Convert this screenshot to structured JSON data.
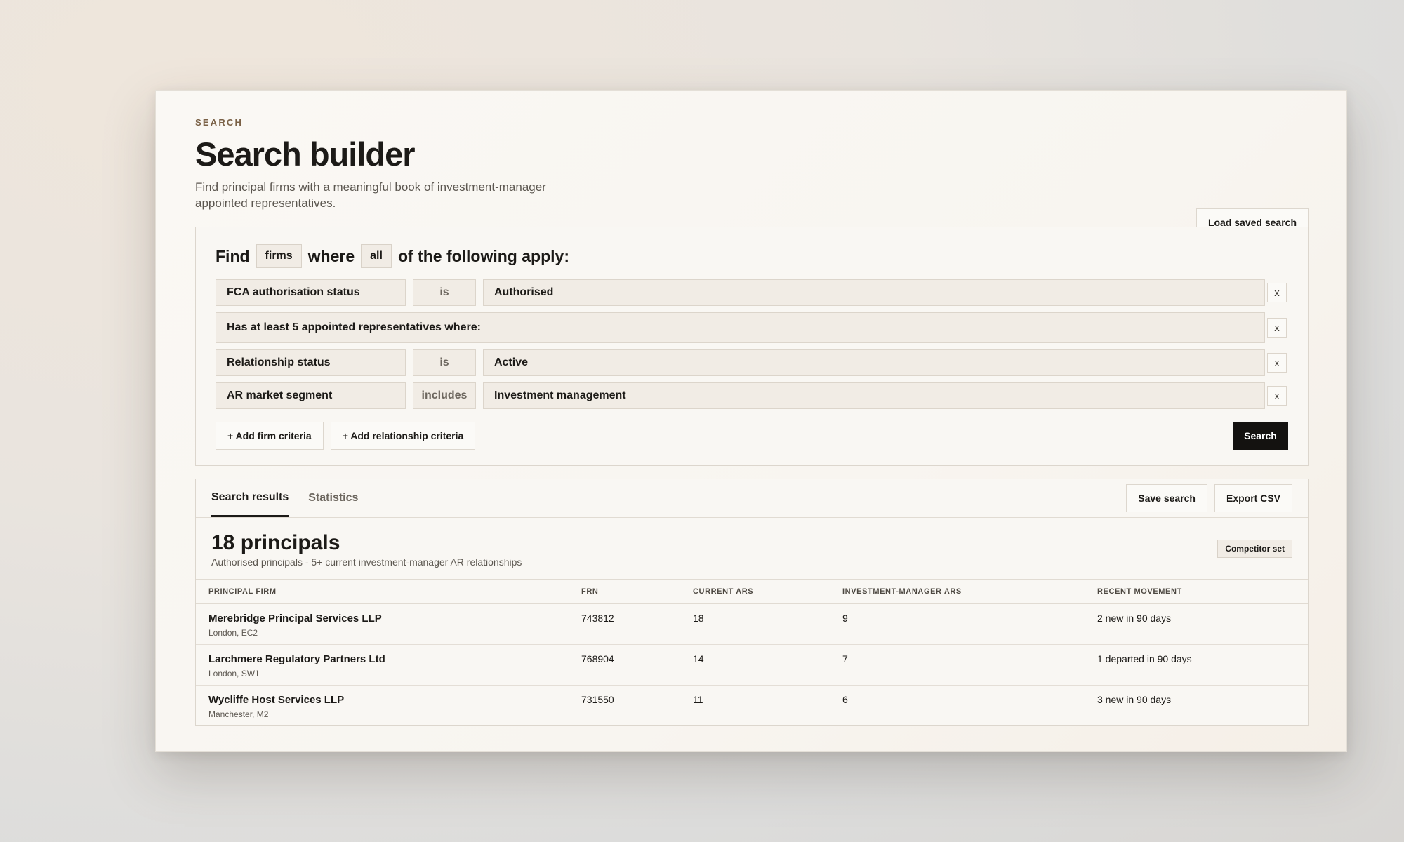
{
  "header": {
    "eyebrow": "SEARCH",
    "title": "Search builder",
    "subtitle": "Find principal firms with a meaningful book of investment-manager appointed representatives.",
    "load_button": "Load saved search"
  },
  "builder": {
    "find_word": "Find",
    "entity": "firms",
    "where_word": "where",
    "match": "all",
    "tail": "of the following apply:",
    "criteria": [
      {
        "field": "FCA authorisation status",
        "op": "is",
        "value": "Authorised"
      },
      {
        "group": "Has at least 5 appointed representatives where:"
      },
      {
        "field": "Relationship status",
        "op": "is",
        "value": "Active"
      },
      {
        "field": "AR market segment",
        "op": "includes",
        "value": "Investment management"
      }
    ],
    "remove_label": "x",
    "add_firm": "+ Add firm criteria",
    "add_relationship": "+ Add relationship criteria",
    "search_button": "Search"
  },
  "results": {
    "tabs": [
      "Search results",
      "Statistics"
    ],
    "save_button": "Save search",
    "export_button": "Export CSV",
    "count": "18 principals",
    "description": "Authorised principals - 5+ current investment-manager AR relationships",
    "tag": "Competitor set",
    "columns": [
      "Principal firm",
      "FRN",
      "Current ARs",
      "Investment-manager ARs",
      "Recent movement"
    ],
    "rows": [
      {
        "name": "Merebridge Principal Services LLP",
        "location": "London, EC2",
        "frn": "743812",
        "current": "18",
        "im": "9",
        "movement": "2 new in 90 days"
      },
      {
        "name": "Larchmere Regulatory Partners Ltd",
        "location": "London, SW1",
        "frn": "768904",
        "current": "14",
        "im": "7",
        "movement": "1 departed in 90 days"
      },
      {
        "name": "Wycliffe Host Services LLP",
        "location": "Manchester, M2",
        "frn": "731550",
        "current": "11",
        "im": "6",
        "movement": "3 new in 90 days"
      }
    ]
  }
}
